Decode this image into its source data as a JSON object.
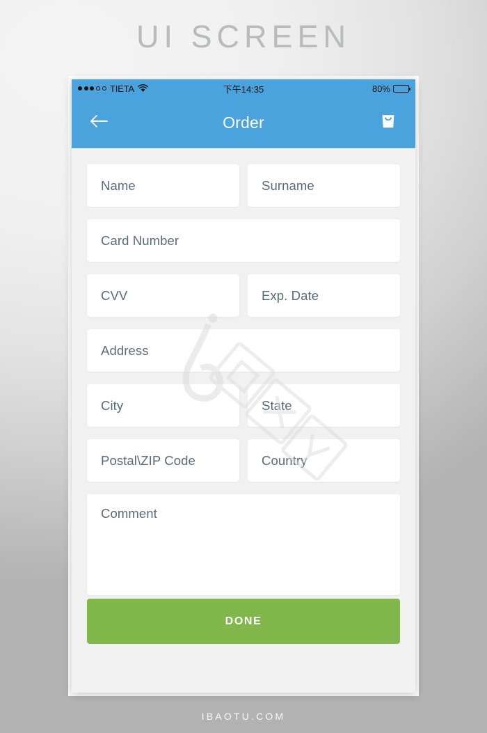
{
  "headline": "UI SCREEN",
  "footer_caption": "IBAOTU.COM",
  "colors": {
    "header_blue": "#4ba3dd",
    "done_green": "#82b74b",
    "placeholder_text": "#5a6b78",
    "screen_bg": "#f1f1f1",
    "field_bg": "#ffffff",
    "headline_gray": "#b9bbbb"
  },
  "statusbar": {
    "signal_dots_filled": 3,
    "signal_dots_empty": 2,
    "carrier": "TIETA",
    "wifi_icon": "wifi-icon",
    "time": "下午14:35",
    "battery_percent": "80%",
    "battery_level": 80
  },
  "navbar": {
    "back_icon": "arrow-left-icon",
    "title": "Order",
    "cart_icon": "shopping-bag-icon"
  },
  "form": {
    "rows": [
      {
        "fields": [
          {
            "placeholder": "Name"
          },
          {
            "placeholder": "Surname"
          }
        ]
      },
      {
        "fields": [
          {
            "placeholder": "Card Number"
          }
        ]
      },
      {
        "fields": [
          {
            "placeholder": "CVV"
          },
          {
            "placeholder": "Exp. Date"
          }
        ]
      },
      {
        "fields": [
          {
            "placeholder": "Address"
          }
        ]
      },
      {
        "fields": [
          {
            "placeholder": "City"
          },
          {
            "placeholder": "State"
          }
        ]
      },
      {
        "fields": [
          {
            "placeholder": "Postal\\ZIP Code"
          },
          {
            "placeholder": "Country"
          }
        ]
      }
    ],
    "comment": {
      "placeholder": "Comment"
    },
    "submit": {
      "label": "DONE"
    }
  },
  "watermark": {
    "logo": "6",
    "text": "包图网"
  }
}
